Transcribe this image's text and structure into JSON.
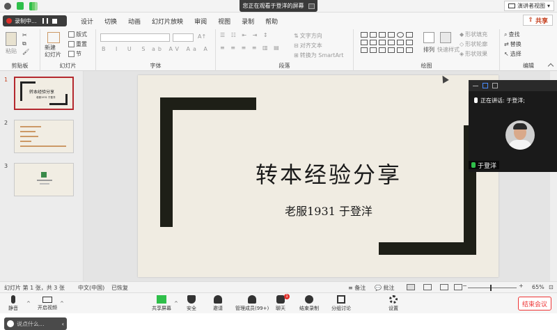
{
  "share_banner": {
    "text": "您正在观看于登洋的屏幕"
  },
  "presenter_view": {
    "label": "演讲者视图"
  },
  "recording": {
    "label": "录制中..."
  },
  "menu": {
    "tabs": [
      "设计",
      "切换",
      "动画",
      "幻灯片放映",
      "审阅",
      "视图",
      "录制",
      "帮助"
    ],
    "share_label": "共享"
  },
  "ribbon": {
    "clipboard": {
      "paste": "粘贴",
      "group": "剪贴板"
    },
    "slides": {
      "new_slide": "新建\n幻灯片",
      "layout": "版式",
      "reset": "重置",
      "section": "节",
      "group": "幻灯片"
    },
    "font": {
      "group": "字体"
    },
    "paragraph": {
      "text_direction": "文字方向",
      "align_text": "对齐文本",
      "smartart": "转换为 SmartArt",
      "group": "段落"
    },
    "drawing": {
      "arrange": "排列",
      "quick_styles": "快速样式",
      "fill": "形状填充",
      "outline": "形状轮廓",
      "effects": "形状效果",
      "group": "绘图"
    },
    "editing": {
      "find": "查找",
      "replace": "替换",
      "select": "选择",
      "group": "编辑"
    }
  },
  "thumbnails": [
    {
      "num": "1",
      "title": "转本经验分享",
      "sub": "老服1931 于登洋"
    },
    {
      "num": "2"
    },
    {
      "num": "3"
    }
  ],
  "chat": {
    "placeholder": "说点什么..."
  },
  "slide": {
    "title": "转本经验分享",
    "subtitle": "老服1931 于登洋"
  },
  "video": {
    "speaking": "正在讲话: 于登洋;",
    "name": "于登洋"
  },
  "status": {
    "slide_count": "幻灯片 第 1 张，共 3 张",
    "language": "中文(中国)",
    "recovered": "已恢复",
    "notes": "备注",
    "comments": "批注",
    "zoom": "65%"
  },
  "meeting": {
    "mute": "静音",
    "video": "开启视频",
    "share": "共享屏幕",
    "security": "安全",
    "invite": "邀请",
    "participants": "管理成员(99+)",
    "chat": "聊天",
    "chat_badge": "1",
    "end_record": "结束录制",
    "breakout": "分组讨论",
    "settings": "设置",
    "end_meeting": "结束会议"
  },
  "colors": {
    "accent_red": "#c43e1c",
    "slide_bg": "#f0ece2",
    "frame": "#1e1f17",
    "record_red": "#e0302a"
  }
}
